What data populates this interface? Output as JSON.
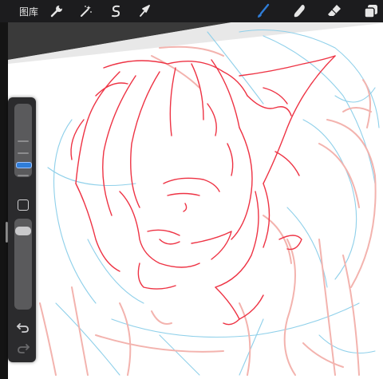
{
  "topbar": {
    "gallery_label": "图库",
    "tools_left": [
      {
        "name": "actions",
        "icon": "wrench-icon"
      },
      {
        "name": "adjustments",
        "icon": "magic-wand-icon"
      },
      {
        "name": "selection",
        "icon": "s-selection-icon"
      },
      {
        "name": "transform",
        "icon": "arrow-cursor-icon"
      }
    ],
    "tools_right": [
      {
        "name": "brush",
        "icon": "brush-icon",
        "active": true
      },
      {
        "name": "smudge",
        "icon": "smudge-icon",
        "active": false
      },
      {
        "name": "eraser",
        "icon": "eraser-icon",
        "active": false
      },
      {
        "name": "layers",
        "icon": "layers-icon",
        "active": false
      }
    ]
  },
  "sidebar": {
    "brush_size_level": 0.2,
    "opacity_level": 0.95,
    "buttons": [
      "modify-button",
      "undo-button",
      "redo-button"
    ]
  },
  "colors": {
    "active_tool": "#2f7dd8",
    "sketch_red": "#ee3344",
    "sketch_pink": "#f3b3ae",
    "sketch_blue": "#8fd0ea",
    "ui_dark": "#1c1c1e"
  }
}
